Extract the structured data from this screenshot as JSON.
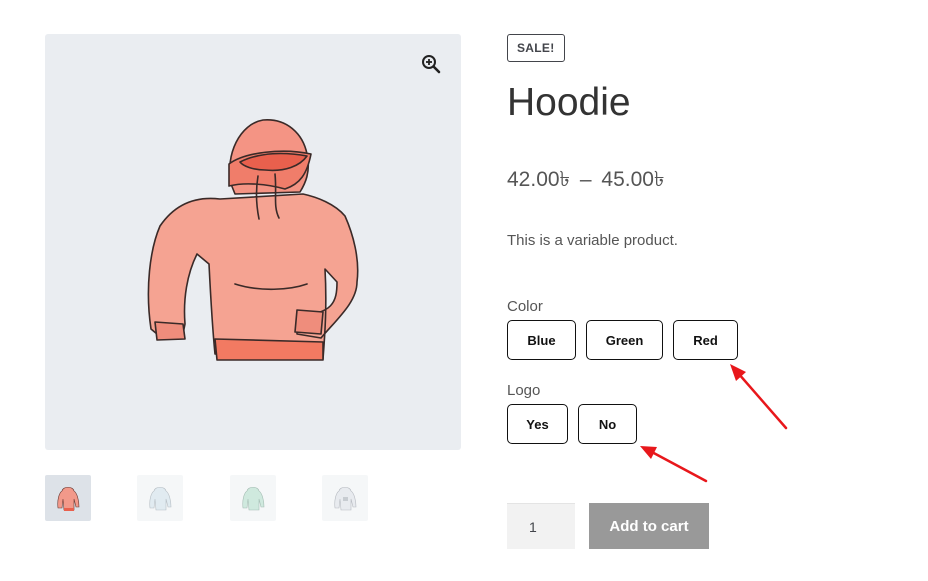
{
  "gallery": {
    "main_image_alt": "Hoodie",
    "zoom_icon": "zoom-in-icon",
    "thumbnails": [
      {
        "color": "#f2998a",
        "active": true
      },
      {
        "color": "#c9dbe6",
        "active": false
      },
      {
        "color": "#a9d8c4",
        "active": false
      },
      {
        "color": "#d6dbe2",
        "active": false
      }
    ]
  },
  "product": {
    "badge": "SALE!",
    "title": "Hoodie",
    "price_min": "42.00৳",
    "price_sep": "–",
    "price_max": "45.00৳",
    "description": "This is a variable product."
  },
  "attributes": {
    "color": {
      "label": "Color",
      "options": [
        "Blue",
        "Green",
        "Red"
      ]
    },
    "logo": {
      "label": "Logo",
      "options": [
        "Yes",
        "No"
      ]
    }
  },
  "cart": {
    "quantity": "1",
    "add_to_cart_label": "Add to cart"
  },
  "colors": {
    "image_bg": "#eaedf1",
    "hoodie": "#f2998a",
    "button_disabled": "#999999",
    "annotation_arrow": "#e8171b"
  }
}
